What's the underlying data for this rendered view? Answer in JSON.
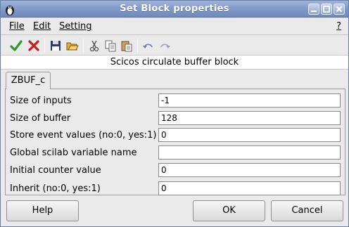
{
  "window": {
    "title": "Set Block properties"
  },
  "menubar": {
    "file": "File",
    "edit": "Edit",
    "setting": "Setting",
    "help": "?"
  },
  "toolbar": {
    "icons": [
      "check-icon",
      "cross-icon",
      "save-icon",
      "open-folder-icon",
      "cut-icon",
      "copy-icon",
      "paste-icon",
      "undo-icon",
      "redo-icon"
    ]
  },
  "subtitle": "Scicos circulate buffer block",
  "tab": {
    "label": "ZBUF_c"
  },
  "fields": [
    {
      "label": "Size of inputs",
      "value": "-1"
    },
    {
      "label": "Size of buffer",
      "value": "128"
    },
    {
      "label": "Store event values (no:0, yes:1)",
      "value": "0"
    },
    {
      "label": "Global scilab variable name",
      "value": ""
    },
    {
      "label": "Initial counter value",
      "value": "0"
    },
    {
      "label": "Inherit (no:0, yes:1)",
      "value": "0"
    }
  ],
  "buttons": {
    "help": "Help",
    "ok": "OK",
    "cancel": "Cancel"
  },
  "colors": {
    "titlebar": "#7f97c6",
    "check": "#2a9a2a",
    "cross": "#cc1a1a"
  }
}
